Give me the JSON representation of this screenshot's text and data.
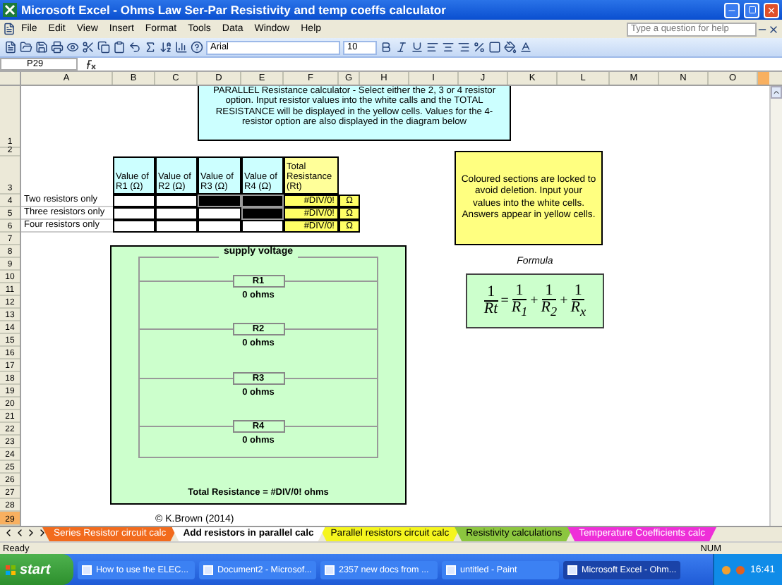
{
  "window": {
    "title": "Microsoft Excel - Ohms Law Ser-Par Resistivity and temp coeffs calculator"
  },
  "menu": [
    "File",
    "Edit",
    "View",
    "Insert",
    "Format",
    "Tools",
    "Data",
    "Window",
    "Help"
  ],
  "help": {
    "placeholder": "Type a question for help"
  },
  "formatting": {
    "font": "Arial",
    "size": "10"
  },
  "name_box": "P29",
  "columns": [
    "A",
    "B",
    "C",
    "D",
    "E",
    "F",
    "G",
    "H",
    "I",
    "J",
    "K",
    "L",
    "M",
    "N",
    "O"
  ],
  "rows": [
    {
      "label": "1",
      "selected": false
    },
    {
      "label": "2",
      "selected": false
    },
    {
      "label": "3",
      "selected": false
    },
    {
      "label": "4",
      "selected": false
    },
    {
      "label": "5",
      "selected": false
    },
    {
      "label": "6",
      "selected": false
    },
    {
      "label": "7",
      "selected": false
    },
    {
      "label": "8",
      "selected": false
    },
    {
      "label": "9",
      "selected": false
    },
    {
      "label": "10",
      "selected": false
    },
    {
      "label": "11",
      "selected": false
    },
    {
      "label": "12",
      "selected": false
    },
    {
      "label": "13",
      "selected": false
    },
    {
      "label": "14",
      "selected": false
    },
    {
      "label": "15",
      "selected": false
    },
    {
      "label": "16",
      "selected": false
    },
    {
      "label": "17",
      "selected": false
    },
    {
      "label": "18",
      "selected": false
    },
    {
      "label": "19",
      "selected": false
    },
    {
      "label": "20",
      "selected": false
    },
    {
      "label": "21",
      "selected": false
    },
    {
      "label": "22",
      "selected": false
    },
    {
      "label": "23",
      "selected": false
    },
    {
      "label": "24",
      "selected": false
    },
    {
      "label": "25",
      "selected": false
    },
    {
      "label": "26",
      "selected": false
    },
    {
      "label": "27",
      "selected": false
    },
    {
      "label": "28",
      "selected": false
    },
    {
      "label": "29",
      "selected": true
    }
  ],
  "table": {
    "headers": [
      "Value of R1 (Ω)",
      "Value of R2 (Ω)",
      "Value of R3 (Ω)",
      "Value of R4 (Ω)",
      "Total Resistance (Rt)"
    ],
    "rows": [
      {
        "label": "Two resistors only",
        "inputs": [
          {
            "locked": false
          },
          {
            "locked": false
          },
          {
            "locked": true
          },
          {
            "locked": true
          }
        ],
        "result": "#DIV/0!",
        "unit": "Ω"
      },
      {
        "label": "Three resistors only",
        "inputs": [
          {
            "locked": false
          },
          {
            "locked": false
          },
          {
            "locked": false
          },
          {
            "locked": true
          }
        ],
        "result": "#DIV/0!",
        "unit": "Ω"
      },
      {
        "label": "Four resistors only",
        "inputs": [
          {
            "locked": false
          },
          {
            "locked": false
          },
          {
            "locked": false
          },
          {
            "locked": false
          }
        ],
        "result": "#DIV/0!",
        "unit": "Ω"
      }
    ]
  },
  "info_box": "PARALLEL Resistance calculator - Select either the 2, 3 or 4 resistor option. Input resistor values into the white calls and the TOTAL RESISTANCE will be displayed in the yellow cells. Values for the 4-resistor option are also displayed in the diagram below",
  "note": "Coloured sections are locked to avoid deletion. Input your values into the white cells. Answers appear in yellow cells.",
  "formula": {
    "label": "Formula",
    "lhs": {
      "num": "1",
      "den": "Rt"
    },
    "terms": [
      {
        "op": "=",
        "num": "1",
        "den": "R$_{1}$"
      },
      {
        "op": "+",
        "num": "1",
        "den": "R$_{2}$"
      },
      {
        "op": "+",
        "num": "1",
        "den": "R$_{x}$"
      }
    ]
  },
  "diagram": {
    "title": "supply voltage",
    "resistors": [
      {
        "label": "R1",
        "value": "0 ohms"
      },
      {
        "label": "R2",
        "value": "0 ohms"
      },
      {
        "label": "R3",
        "value": "0 ohms"
      },
      {
        "label": "R4",
        "value": "0 ohms"
      }
    ],
    "total": "Total Resistance = #DIV/0!  ohms"
  },
  "copyright": "© K.Brown (2014)",
  "sheet_tabs": [
    {
      "label": "Series Resistor circuit calc",
      "color": "#f26b1d",
      "selected": false
    },
    {
      "label": "Add resistors in parallel calc",
      "color": "#ffffff",
      "selected": true
    },
    {
      "label": "Parallel resistors circuit calc",
      "color": "#f5f51e",
      "selected": false
    },
    {
      "label": "Resistivity calculations",
      "color": "#8cc63f",
      "selected": false
    },
    {
      "label": "Temperature Coefficients calc",
      "color": "#ee2fd8",
      "selected": false
    }
  ],
  "status": {
    "left": "Ready",
    "right": "NUM"
  },
  "taskbar": {
    "start": "start",
    "items": [
      {
        "label": "How to use the ELEC...",
        "active": false
      },
      {
        "label": "Document2 - Microsof...",
        "active": false
      },
      {
        "label": "2357 new docs from ...",
        "active": false
      },
      {
        "label": "untitled - Paint",
        "active": false
      },
      {
        "label": "Microsoft Excel - Ohm...",
        "active": true
      }
    ],
    "clock": "16:41"
  }
}
